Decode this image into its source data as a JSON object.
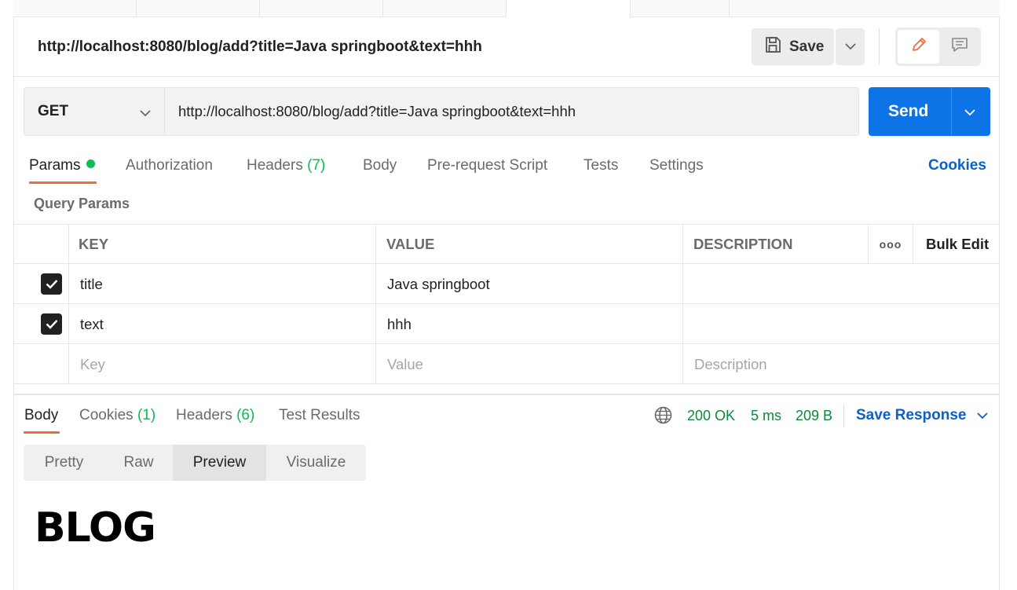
{
  "request": {
    "name": "http://localhost:8080/blog/add?title=Java springboot&text=hhh",
    "save_label": "Save",
    "method": "GET",
    "url": "http://localhost:8080/blog/add?title=Java springboot&text=hhh",
    "send_label": "Send"
  },
  "request_tabs": {
    "params": "Params",
    "authorization": "Authorization",
    "headers": "Headers",
    "headers_count": "(7)",
    "body": "Body",
    "prerequest": "Pre-request Script",
    "tests": "Tests",
    "settings": "Settings",
    "cookies": "Cookies"
  },
  "query_params": {
    "title": "Query Params",
    "headers": {
      "key": "KEY",
      "value": "VALUE",
      "description": "DESCRIPTION",
      "more": "ooo",
      "bulk_edit": "Bulk Edit"
    },
    "rows": [
      {
        "checked": true,
        "key": "title",
        "value": "Java springboot",
        "description": ""
      },
      {
        "checked": true,
        "key": "text",
        "value": "hhh",
        "description": ""
      }
    ],
    "placeholders": {
      "key": "Key",
      "value": "Value",
      "description": "Description"
    }
  },
  "response": {
    "tabs": {
      "body": "Body",
      "cookies": "Cookies",
      "cookies_count": "(1)",
      "headers": "Headers",
      "headers_count": "(6)",
      "test_results": "Test Results"
    },
    "status": "200 OK",
    "time": "5 ms",
    "size": "209 B",
    "save_response": "Save Response",
    "views": {
      "pretty": "Pretty",
      "raw": "Raw",
      "preview": "Preview",
      "visualize": "Visualize"
    },
    "preview_content": "BLOG"
  },
  "icons": {
    "save": "floppy-disk-icon",
    "edit": "pencil-icon",
    "comment": "comment-icon",
    "globe": "globe-icon",
    "chevron": "chevron-down-icon",
    "check": "checkmark-icon"
  },
  "colors": {
    "accent": "#0d74e7",
    "link": "#0d5fc9",
    "active_underline": "#f26b3a",
    "success": "#0cbb52",
    "status_text": "#0a8a3b"
  }
}
